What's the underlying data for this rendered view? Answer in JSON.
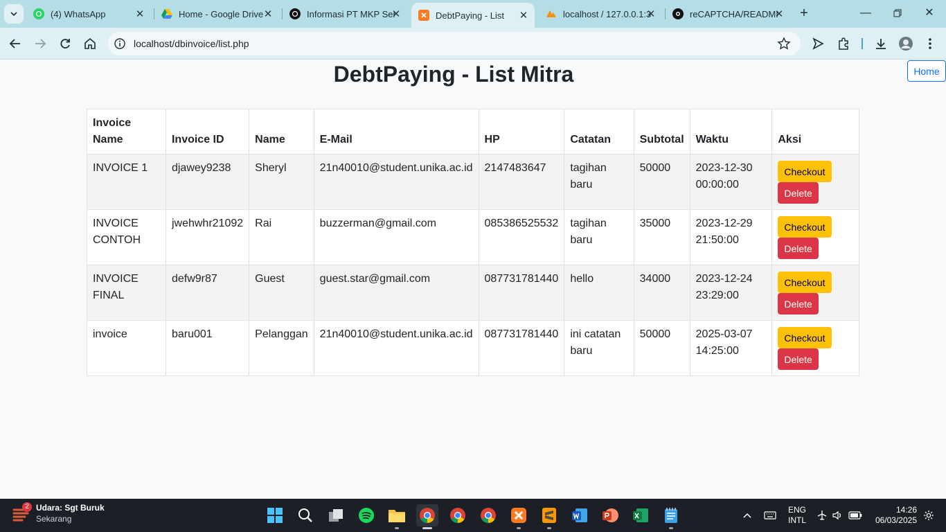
{
  "browser": {
    "tabs": [
      {
        "title": "(4) WhatsApp",
        "icon": "whatsapp-icon"
      },
      {
        "title": "Home - Google Drive",
        "icon": "google-drive-icon"
      },
      {
        "title": "Informasi PT MKP Ser",
        "icon": "chatgpt-icon"
      },
      {
        "title": "DebtPaying - List",
        "icon": "xampp-icon"
      },
      {
        "title": "localhost / 127.0.0.1:3",
        "icon": "phpmyadmin-icon"
      },
      {
        "title": "reCAPTCHA/READMI",
        "icon": "github-icon"
      }
    ],
    "active_tab": 3,
    "url": "localhost/dbinvoice/list.php"
  },
  "page": {
    "title": "DebtPaying - List Mitra",
    "home_label": "Home",
    "table": {
      "headers": [
        "Invoice Name",
        "Invoice ID",
        "Name",
        "E-Mail",
        "HP",
        "Catatan",
        "Subtotal",
        "Waktu",
        "Aksi"
      ],
      "rows": [
        {
          "invoice_name": "INVOICE 1",
          "invoice_id": "djawey9238",
          "name": "Sheryl",
          "email": "21n40010@student.unika.ac.id",
          "hp": "2147483647",
          "catatan": "tagihan baru",
          "subtotal": "50000",
          "waktu": "2023-12-30 00:00:00"
        },
        {
          "invoice_name": "INVOICE CONTOH",
          "invoice_id": "jwehwhr21092",
          "name": "Rai",
          "email": "buzzerman@gmail.com",
          "hp": "085386525532",
          "catatan": "tagihan baru",
          "subtotal": "35000",
          "waktu": "2023-12-29 21:50:00"
        },
        {
          "invoice_name": "INVOICE FINAL",
          "invoice_id": "defw9r87",
          "name": "Guest",
          "email": "guest.star@gmail.com",
          "hp": "087731781440",
          "catatan": "hello",
          "subtotal": "34000",
          "waktu": "2023-12-24 23:29:00"
        },
        {
          "invoice_name": "invoice",
          "invoice_id": "baru001",
          "name": "Pelanggan",
          "email": "21n40010@student.unika.ac.id",
          "hp": "087731781440",
          "catatan": "ini catatan baru",
          "subtotal": "50000",
          "waktu": "2025-03-07 14:25:00"
        }
      ],
      "checkout_label": "Checkout",
      "delete_label": "Delete"
    }
  },
  "taskbar": {
    "weather_title": "Udara: Sgt Buruk",
    "weather_sub": "Sekarang",
    "weather_badge": "2",
    "lang_1": "ENG",
    "lang_2": "INTL",
    "time": "14:26",
    "date": "06/03/2025"
  },
  "colors": {
    "tabbar": "#b4dde6",
    "toolbar": "#dff0f5",
    "checkout": "#ffc107",
    "delete": "#dc3545",
    "home_outline": "#0d6efd"
  }
}
